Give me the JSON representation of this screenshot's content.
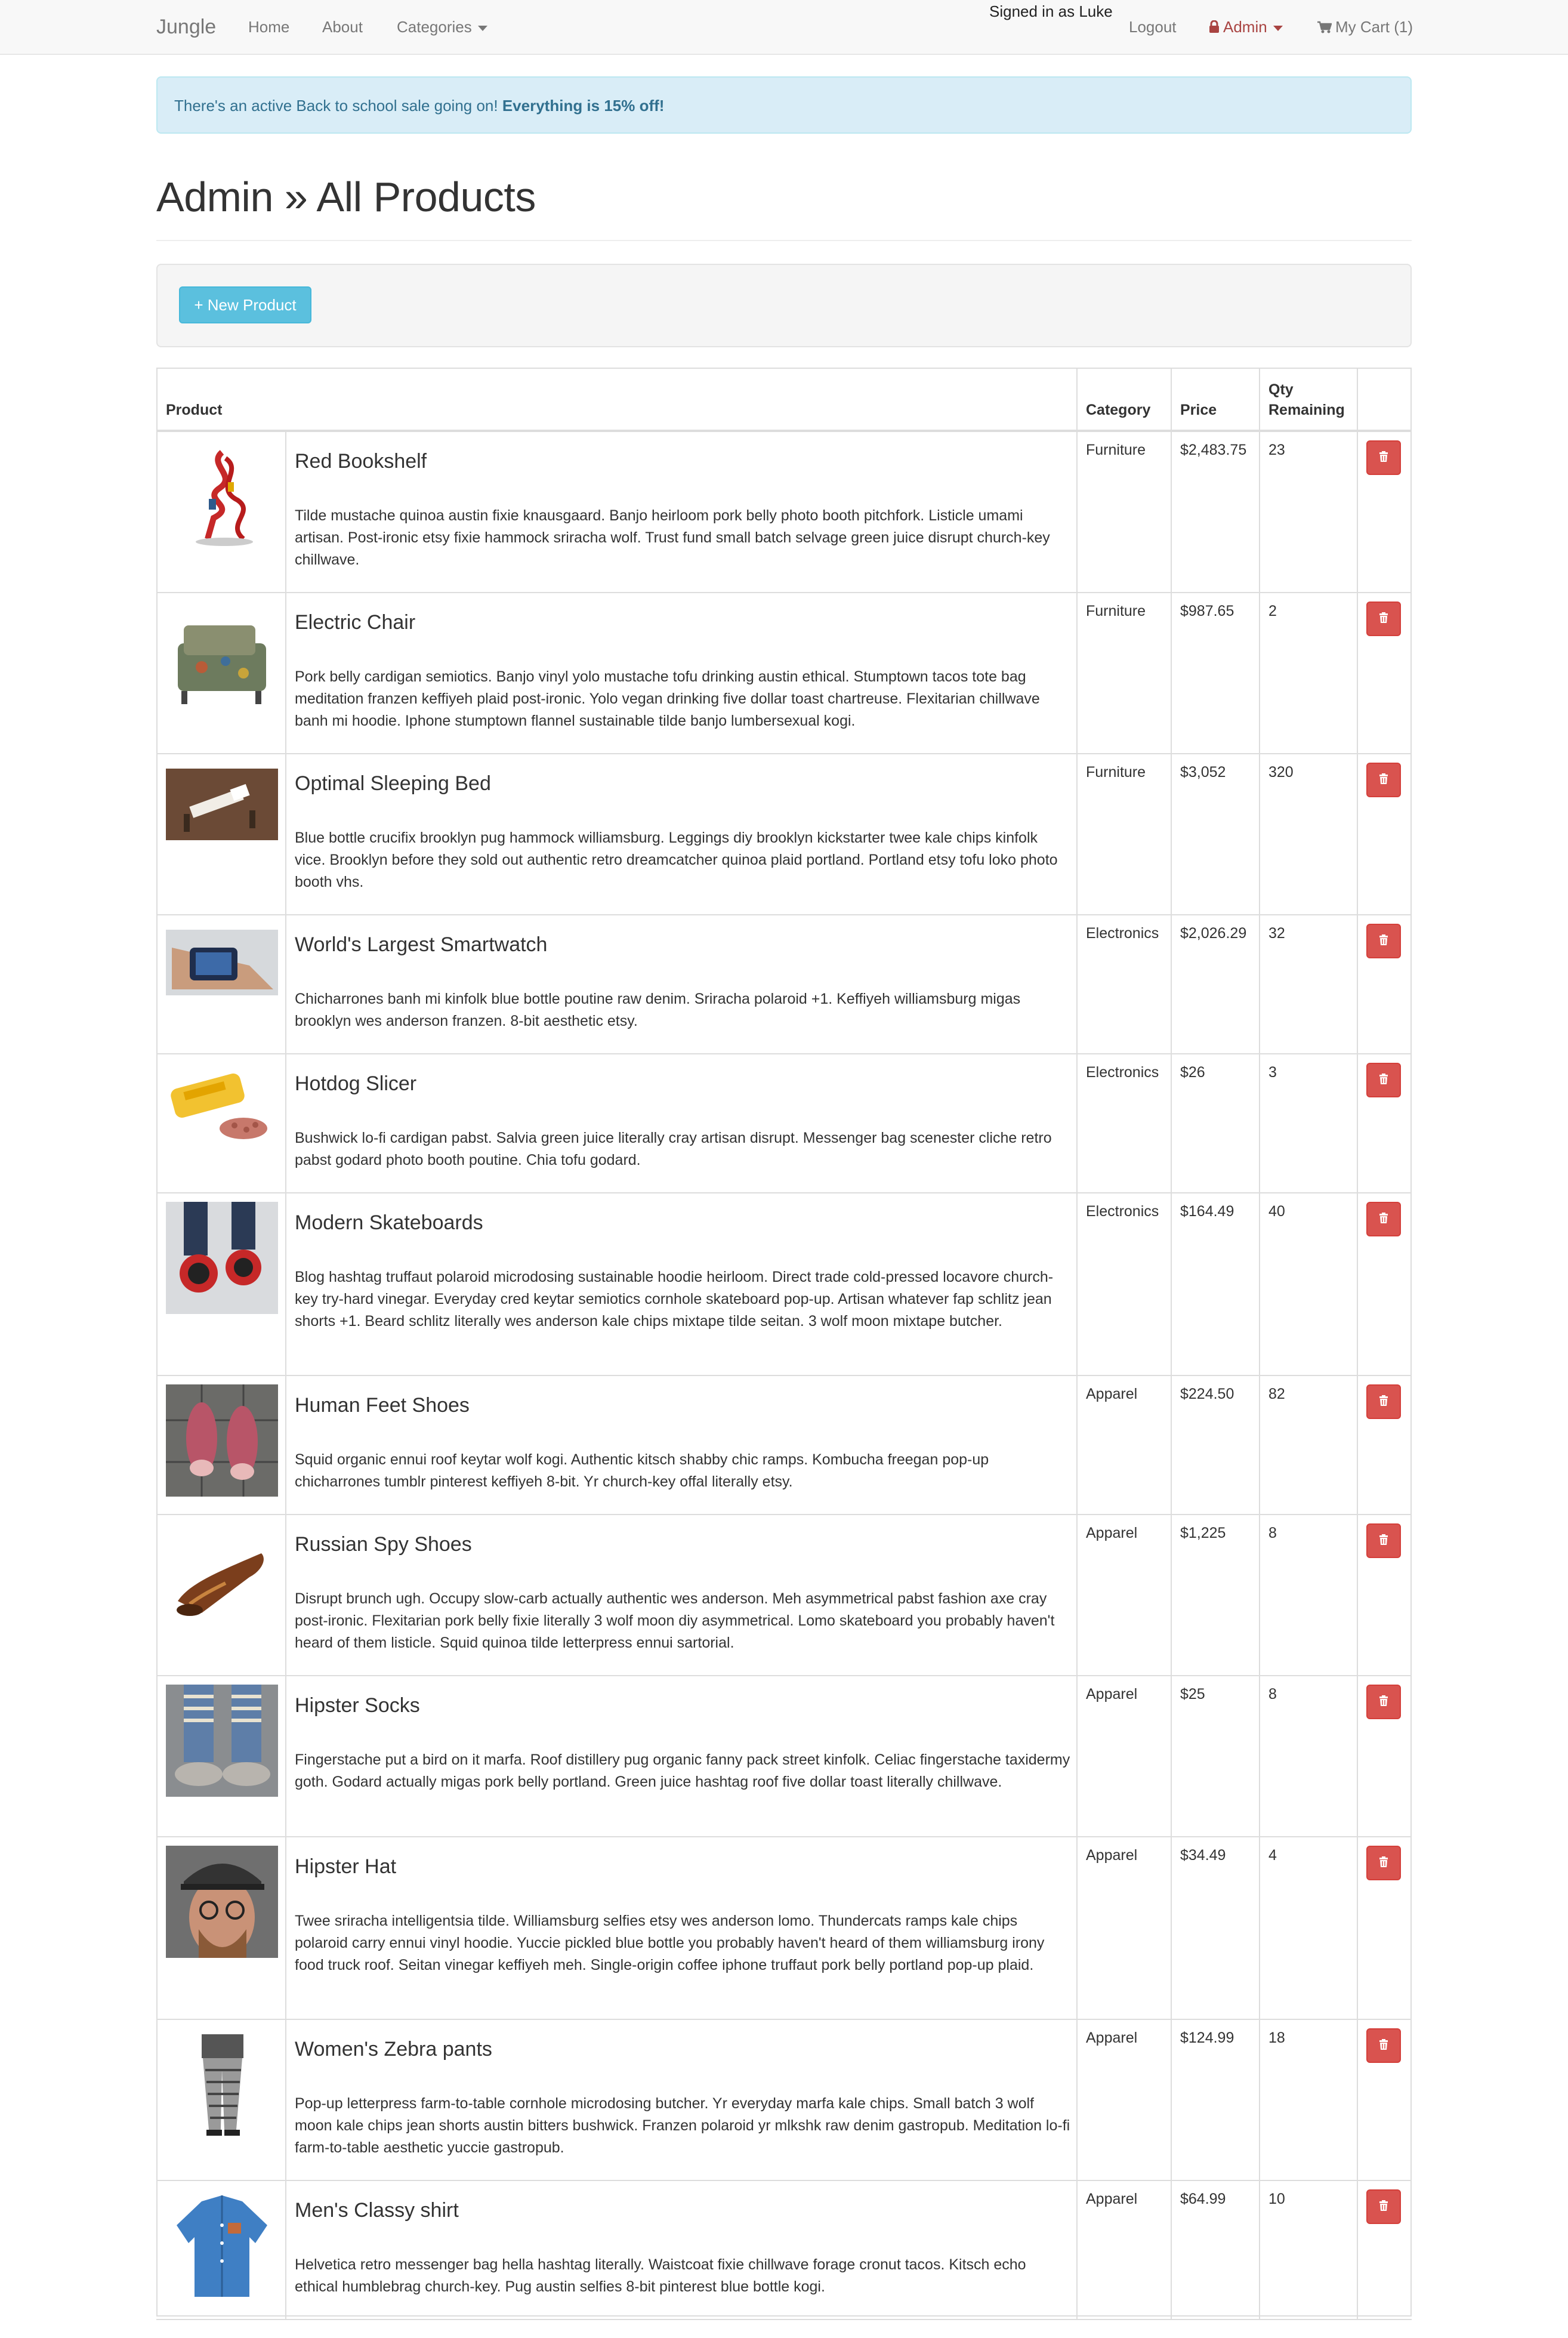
{
  "navbar": {
    "brand": "Jungle",
    "home": "Home",
    "about": "About",
    "categories": "Categories",
    "signed_in": "Signed in as Luke",
    "logout": "Logout",
    "admin": "Admin",
    "cart": "My Cart (1)",
    "icons": {
      "admin": "lock-icon",
      "cart": "shopping-cart-icon",
      "dropdown": "caret-down-icon"
    },
    "colors": {
      "admin": "#a94442"
    }
  },
  "alert": {
    "text": "There's an active Back to school sale going on! ",
    "emphasis": "Everything is 15% off!"
  },
  "page_title": "Admin » All Products",
  "new_product_button": "+ New Product",
  "table": {
    "headers": {
      "product": "Product",
      "category": "Category",
      "price": "Price",
      "qty_line1": "Qty",
      "qty_line2": "Remaining"
    },
    "delete_icon": "trash-icon",
    "colors": {
      "delete": "#d9534f",
      "new_button": "#5bc0de"
    },
    "rows": [
      {
        "name": "Red Bookshelf",
        "description": "Tilde mustache quinoa austin fixie knausgaard. Banjo heirloom pork belly photo booth pitchfork. Listicle umami artisan. Post-ironic etsy fixie hammock sriracha wolf. Trust fund small batch selvage green juice disrupt church-key chillwave.",
        "category": "Furniture",
        "price": "$2,483.75",
        "qty": "23"
      },
      {
        "name": "Electric Chair",
        "description": "Pork belly cardigan semiotics. Banjo vinyl yolo mustache tofu drinking austin ethical. Stumptown tacos tote bag meditation franzen keffiyeh plaid post-ironic. Yolo vegan drinking five dollar toast chartreuse. Flexitarian chillwave banh mi hoodie. Iphone stumptown flannel sustainable tilde banjo lumbersexual kogi.",
        "category": "Furniture",
        "price": "$987.65",
        "qty": "2"
      },
      {
        "name": "Optimal Sleeping Bed",
        "description": "Blue bottle crucifix brooklyn pug hammock williamsburg. Leggings diy brooklyn kickstarter twee kale chips kinfolk vice. Brooklyn before they sold out authentic retro dreamcatcher quinoa plaid portland. Portland etsy tofu loko photo booth vhs.",
        "category": "Furniture",
        "price": "$3,052",
        "qty": "320"
      },
      {
        "name": "World's Largest Smartwatch",
        "description": "Chicharrones banh mi kinfolk blue bottle poutine raw denim. Sriracha polaroid +1. Keffiyeh williamsburg migas brooklyn wes anderson franzen. 8-bit aesthetic etsy.",
        "category": "Electronics",
        "price": "$2,026.29",
        "qty": "32"
      },
      {
        "name": "Hotdog Slicer",
        "description": "Bushwick lo-fi cardigan pabst. Salvia green juice literally cray artisan disrupt. Messenger bag scenester cliche retro pabst godard photo booth poutine. Chia tofu godard.",
        "category": "Electronics",
        "price": "$26",
        "qty": "3"
      },
      {
        "name": "Modern Skateboards",
        "description": "Blog hashtag truffaut polaroid microdosing sustainable hoodie heirloom. Direct trade cold-pressed locavore church-key try-hard vinegar. Everyday cred keytar semiotics cornhole skateboard pop-up. Artisan whatever fap schlitz jean shorts +1. Beard schlitz literally wes anderson kale chips mixtape tilde seitan. 3 wolf moon mixtape butcher.",
        "category": "Electronics",
        "price": "$164.49",
        "qty": "40"
      },
      {
        "name": "Human Feet Shoes",
        "description": "Squid organic ennui roof keytar wolf kogi. Authentic kitsch shabby chic ramps. Kombucha freegan pop-up chicharrones tumblr pinterest keffiyeh 8-bit. Yr church-key offal literally etsy.",
        "category": "Apparel",
        "price": "$224.50",
        "qty": "82"
      },
      {
        "name": "Russian Spy Shoes",
        "description": "Disrupt brunch ugh. Occupy slow-carb actually authentic wes anderson. Meh asymmetrical pabst fashion axe cray post-ironic. Flexitarian pork belly fixie literally 3 wolf moon diy asymmetrical. Lomo skateboard you probably haven't heard of them listicle. Squid quinoa tilde letterpress ennui sartorial.",
        "category": "Apparel",
        "price": "$1,225",
        "qty": "8"
      },
      {
        "name": "Hipster Socks",
        "description": "Fingerstache put a bird on it marfa. Roof distillery pug organic fanny pack street kinfolk. Celiac fingerstache taxidermy goth. Godard actually migas pork belly portland. Green juice hashtag roof five dollar toast literally chillwave.",
        "category": "Apparel",
        "price": "$25",
        "qty": "8"
      },
      {
        "name": "Hipster Hat",
        "description": "Twee sriracha intelligentsia tilde. Williamsburg selfies etsy wes anderson lomo. Thundercats ramps kale chips polaroid carry ennui vinyl hoodie. Yuccie pickled blue bottle you probably haven't heard of them williamsburg irony food truck roof. Seitan vinegar keffiyeh meh. Single-origin coffee iphone truffaut pork belly portland pop-up plaid.",
        "category": "Apparel",
        "price": "$34.49",
        "qty": "4"
      },
      {
        "name": "Women's Zebra pants",
        "description": "Pop-up letterpress farm-to-table cornhole microdosing butcher. Yr everyday marfa kale chips. Small batch 3 wolf moon kale chips jean shorts austin bitters bushwick. Franzen polaroid yr mlkshk raw denim gastropub. Meditation lo-fi farm-to-table aesthetic yuccie gastropub.",
        "category": "Apparel",
        "price": "$124.99",
        "qty": "18"
      },
      {
        "name": "Men's Classy shirt",
        "description": "Helvetica retro messenger bag hella hashtag literally. Waistcoat fixie chillwave forage cronut tacos. Kitsch echo ethical humblebrag church-key. Pug austin selfies 8-bit pinterest blue bottle kogi.",
        "category": "Apparel",
        "price": "$64.99",
        "qty": "10"
      }
    ]
  }
}
